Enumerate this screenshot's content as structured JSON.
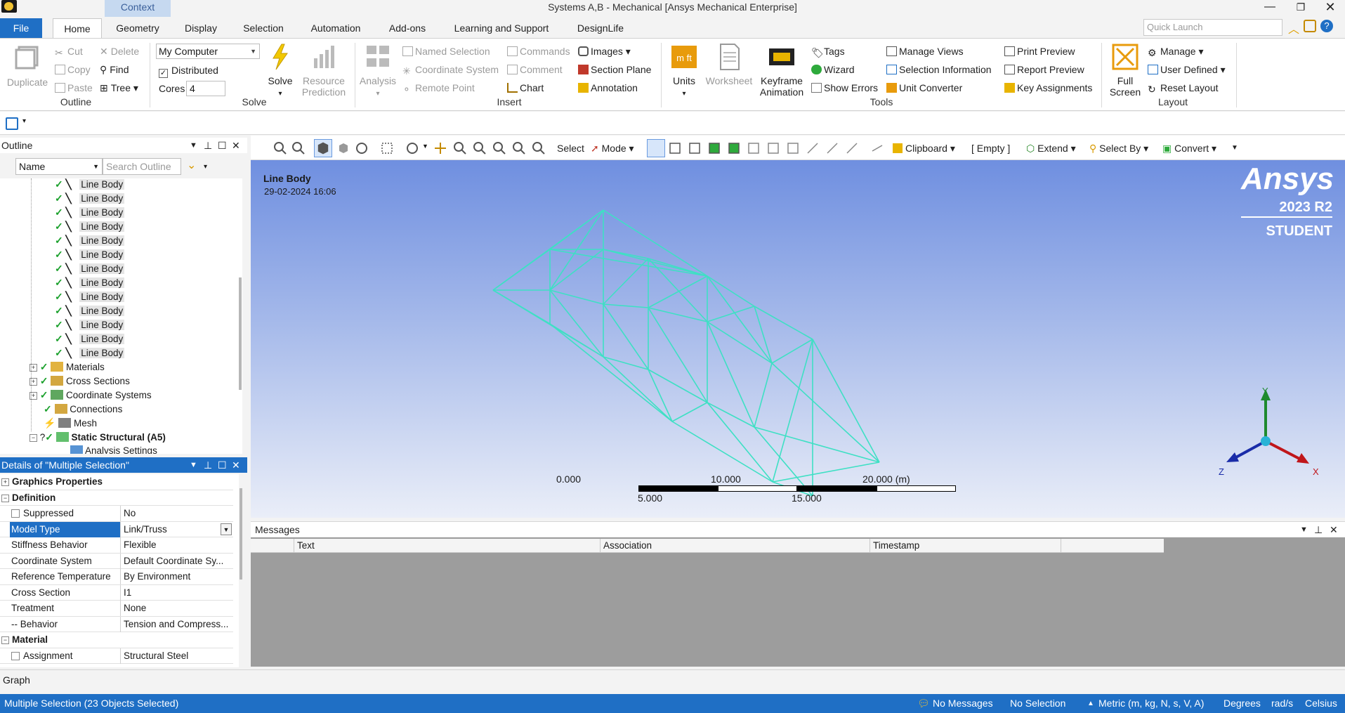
{
  "window": {
    "title": "Systems A,B - Mechanical [Ansys Mechanical Enterprise]",
    "context_tab": "Context"
  },
  "tabs": [
    "File",
    "Home",
    "Geometry",
    "Display",
    "Selection",
    "Automation",
    "Add-ons",
    "Learning and Support",
    "DesignLife"
  ],
  "quick_launch": {
    "placeholder": "Quick Launch"
  },
  "ribbon": {
    "outline": {
      "group": "Outline",
      "duplicate": "Duplicate",
      "cut": "Cut",
      "copy": "Copy",
      "paste": "Paste",
      "delete": "Delete",
      "find": "Find",
      "tree": "Tree"
    },
    "solve": {
      "group": "Solve",
      "computer": "My Computer",
      "distributed": "Distributed",
      "cores_label": "Cores",
      "cores_value": "4",
      "solve": "Solve",
      "resource_prediction_1": "Resource",
      "resource_prediction_2": "Prediction"
    },
    "insert": {
      "group": "Insert",
      "analysis": "Analysis",
      "named_selection": "Named Selection",
      "coordinate_system": "Coordinate System",
      "remote_point": "Remote Point",
      "commands": "Commands",
      "comment": "Comment",
      "chart": "Chart",
      "images": "Images",
      "section_plane": "Section Plane",
      "annotation": "Annotation"
    },
    "tools": {
      "group": "Tools",
      "units": "Units",
      "worksheet": "Worksheet",
      "keyframe_1": "Keyframe",
      "keyframe_2": "Animation",
      "tags": "Tags",
      "wizard": "Wizard",
      "show_errors": "Show Errors",
      "manage_views": "Manage Views",
      "selection_information": "Selection Information",
      "unit_converter": "Unit Converter",
      "print_preview": "Print Preview",
      "report_preview": "Report Preview",
      "key_assignments": "Key Assignments"
    },
    "layout": {
      "group": "Layout",
      "full_screen_1": "Full",
      "full_screen_2": "Screen",
      "manage": "Manage",
      "user_defined": "User Defined",
      "reset_layout": "Reset Layout"
    }
  },
  "outline": {
    "title": "Outline",
    "name_filter": "Name",
    "search_placeholder": "Search Outline",
    "line_bodies": [
      "Line Body",
      "Line Body",
      "Line Body",
      "Line Body",
      "Line Body",
      "Line Body",
      "Line Body",
      "Line Body",
      "Line Body",
      "Line Body",
      "Line Body",
      "Line Body",
      "Line Body"
    ],
    "nodes": {
      "materials": "Materials",
      "cross_sections": "Cross Sections",
      "coordinate_systems": "Coordinate Systems",
      "connections": "Connections",
      "mesh": "Mesh",
      "static_structural": "Static Structural (A5)",
      "analysis_settings": "Analysis Settings"
    }
  },
  "details": {
    "title": "Details of \"Multiple Selection\"",
    "rows": [
      {
        "key": "Graphics Properties",
        "value": "",
        "category": true,
        "collapsed": true
      },
      {
        "key": "Definition",
        "value": "",
        "category": true
      },
      {
        "key": "Suppressed",
        "value": "No"
      },
      {
        "key": "Model Type",
        "value": "Link/Truss"
      },
      {
        "key": "Stiffness Behavior",
        "value": "Flexible"
      },
      {
        "key": "Coordinate System",
        "value": "Default Coordinate Sy..."
      },
      {
        "key": "Reference Temperature",
        "value": "By Environment"
      },
      {
        "key": "Cross Section",
        "value": "I1"
      },
      {
        "key": "Treatment",
        "value": "None"
      },
      {
        "key": "-- Behavior",
        "value": "Tension and Compress..."
      },
      {
        "key": "Material",
        "value": "",
        "category": true
      },
      {
        "key": "Assignment",
        "value": "Structural Steel"
      }
    ]
  },
  "graphics_toolbar": {
    "select": "Select",
    "mode": "Mode",
    "clipboard": "Clipboard",
    "empty": "[ Empty ]",
    "extend": "Extend",
    "select_by": "Select By",
    "convert": "Convert"
  },
  "viewport": {
    "label": "Line Body",
    "timestamp": "29-02-2024 16:06",
    "brand": "Ansys",
    "version": "2023 R2",
    "edition": "STUDENT",
    "scale_top": [
      "0.000",
      "10.000",
      "20.000 (m)"
    ],
    "scale_bottom": [
      "5.000",
      "15.000"
    ],
    "axes": {
      "x": "X",
      "y": "Y",
      "z": "Z"
    },
    "mesh_color": "#3ee0c4"
  },
  "messages": {
    "title": "Messages",
    "columns": [
      "Text",
      "Association",
      "Timestamp"
    ]
  },
  "graph_tab": "Graph",
  "status": {
    "selection": "Multiple Selection (23 Objects Selected)",
    "messages": "No Messages",
    "no_selection": "No Selection",
    "units": "Metric (m, kg, N, s, V, A)",
    "degrees": "Degrees",
    "rads": "rad/s",
    "temp": "Celsius"
  },
  "colors": {
    "accent": "#1f6fc5",
    "check": "#1aa02b"
  }
}
